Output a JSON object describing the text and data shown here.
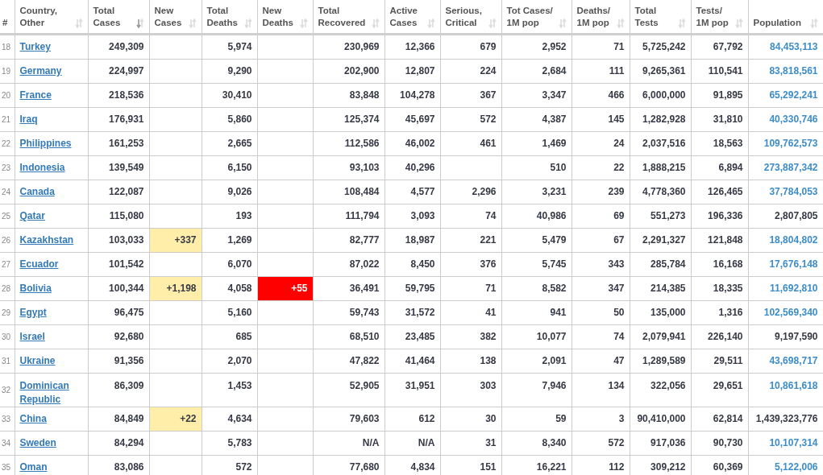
{
  "table": {
    "columns": [
      {
        "label": "#"
      },
      {
        "label": "Country,\nOther",
        "sortable": true,
        "sorted": false
      },
      {
        "label": "Total\nCases",
        "sortable": true,
        "sorted": true
      },
      {
        "label": "New\nCases",
        "sortable": true,
        "sorted": false
      },
      {
        "label": "Total\nDeaths",
        "sortable": true,
        "sorted": false
      },
      {
        "label": "New\nDeaths",
        "sortable": true,
        "sorted": false
      },
      {
        "label": "Total\nRecovered",
        "sortable": true,
        "sorted": false
      },
      {
        "label": "Active\nCases",
        "sortable": true,
        "sorted": false
      },
      {
        "label": "Serious,\nCritical",
        "sortable": true,
        "sorted": false
      },
      {
        "label": "Tot Cases/\n1M pop",
        "sortable": true,
        "sorted": false
      },
      {
        "label": "Deaths/\n1M pop",
        "sortable": true,
        "sorted": false
      },
      {
        "label": "Total\nTests",
        "sortable": true,
        "sorted": false
      },
      {
        "label": "Tests/\n1M pop",
        "sortable": true,
        "sorted": false
      },
      {
        "label": "Population",
        "sortable": true,
        "sorted": false
      }
    ],
    "rows": [
      {
        "cells": [
          "18",
          "Turkey",
          "249,309",
          null,
          "5,974",
          null,
          "230,969",
          "12,366",
          "679",
          "2,952",
          "71",
          "5,725,242",
          "67,792",
          "84,453,113"
        ],
        "population_linked": true
      },
      {
        "cells": [
          "19",
          "Germany",
          "224,997",
          null,
          "9,290",
          null,
          "202,900",
          "12,807",
          "224",
          "2,684",
          "111",
          "9,265,361",
          "110,541",
          "83,818,561"
        ],
        "population_linked": true
      },
      {
        "cells": [
          "20",
          "France",
          "218,536",
          null,
          "30,410",
          null,
          "83,848",
          "104,278",
          "367",
          "3,347",
          "466",
          "6,000,000",
          "91,895",
          "65,292,241"
        ],
        "population_linked": true
      },
      {
        "cells": [
          "21",
          "Iraq",
          "176,931",
          null,
          "5,860",
          null,
          "125,374",
          "45,697",
          "572",
          "4,387",
          "145",
          "1,282,928",
          "31,810",
          "40,330,746"
        ],
        "population_linked": true
      },
      {
        "cells": [
          "22",
          "Philippines",
          "161,253",
          null,
          "2,665",
          null,
          "112,586",
          "46,002",
          "461",
          "1,469",
          "24",
          "2,037,516",
          "18,563",
          "109,762,573"
        ],
        "population_linked": true
      },
      {
        "cells": [
          "23",
          "Indonesia",
          "139,549",
          null,
          "6,150",
          null,
          "93,103",
          "40,296",
          null,
          "510",
          "22",
          "1,888,215",
          "6,894",
          "273,887,342"
        ],
        "population_linked": true
      },
      {
        "cells": [
          "24",
          "Canada",
          "122,087",
          null,
          "9,026",
          null,
          "108,484",
          "4,577",
          "2,296",
          "3,231",
          "239",
          "4,778,360",
          "126,465",
          "37,784,053"
        ],
        "population_linked": true
      },
      {
        "cells": [
          "25",
          "Qatar",
          "115,080",
          null,
          "193",
          null,
          "111,794",
          "3,093",
          "74",
          "40,986",
          "69",
          "551,273",
          "196,336",
          "2,807,805"
        ],
        "population_linked": false
      },
      {
        "cells": [
          "26",
          "Kazakhstan",
          "103,033",
          "+337",
          "1,269",
          null,
          "82,777",
          "18,987",
          "221",
          "5,479",
          "67",
          "2,291,327",
          "121,848",
          "18,804,802"
        ],
        "population_linked": true
      },
      {
        "cells": [
          "27",
          "Ecuador",
          "101,542",
          null,
          "6,070",
          null,
          "87,022",
          "8,450",
          "376",
          "5,745",
          "343",
          "285,784",
          "16,168",
          "17,676,148"
        ],
        "population_linked": true
      },
      {
        "cells": [
          "28",
          "Bolivia",
          "100,344",
          "+1,198",
          "4,058",
          "+55",
          "36,491",
          "59,795",
          "71",
          "8,582",
          "347",
          "214,385",
          "18,335",
          "11,692,810"
        ],
        "population_linked": true
      },
      {
        "cells": [
          "29",
          "Egypt",
          "96,475",
          null,
          "5,160",
          null,
          "59,743",
          "31,572",
          "41",
          "941",
          "50",
          "135,000",
          "1,316",
          "102,569,340"
        ],
        "population_linked": true
      },
      {
        "cells": [
          "30",
          "Israel",
          "92,680",
          null,
          "685",
          null,
          "68,510",
          "23,485",
          "382",
          "10,077",
          "74",
          "2,079,941",
          "226,140",
          "9,197,590"
        ],
        "population_linked": false
      },
      {
        "cells": [
          "31",
          "Ukraine",
          "91,356",
          null,
          "2,070",
          null,
          "47,822",
          "41,464",
          "138",
          "2,091",
          "47",
          "1,289,589",
          "29,511",
          "43,698,717"
        ],
        "population_linked": true
      },
      {
        "cells": [
          "32",
          "Dominican\nRepublic",
          "86,309",
          null,
          "1,453",
          null,
          "52,905",
          "31,951",
          "303",
          "7,946",
          "134",
          "322,056",
          "29,651",
          "10,861,618"
        ],
        "population_linked": true
      },
      {
        "cells": [
          "33",
          "China",
          "84,849",
          "+22",
          "4,634",
          null,
          "79,603",
          "612",
          "30",
          "59",
          "3",
          "90,410,000",
          "62,814",
          "1,439,323,776"
        ],
        "population_linked": false
      },
      {
        "cells": [
          "34",
          "Sweden",
          "84,294",
          null,
          "5,783",
          null,
          "N/A",
          "N/A",
          "31",
          "8,340",
          "572",
          "917,036",
          "90,730",
          "10,107,314"
        ],
        "population_linked": true
      },
      {
        "cells": [
          "35",
          "Oman",
          "83,086",
          null,
          "572",
          null,
          "77,680",
          "4,834",
          "151",
          "16,221",
          "112",
          "309,212",
          "60,369",
          "5,122,006"
        ],
        "population_linked": true
      }
    ]
  }
}
